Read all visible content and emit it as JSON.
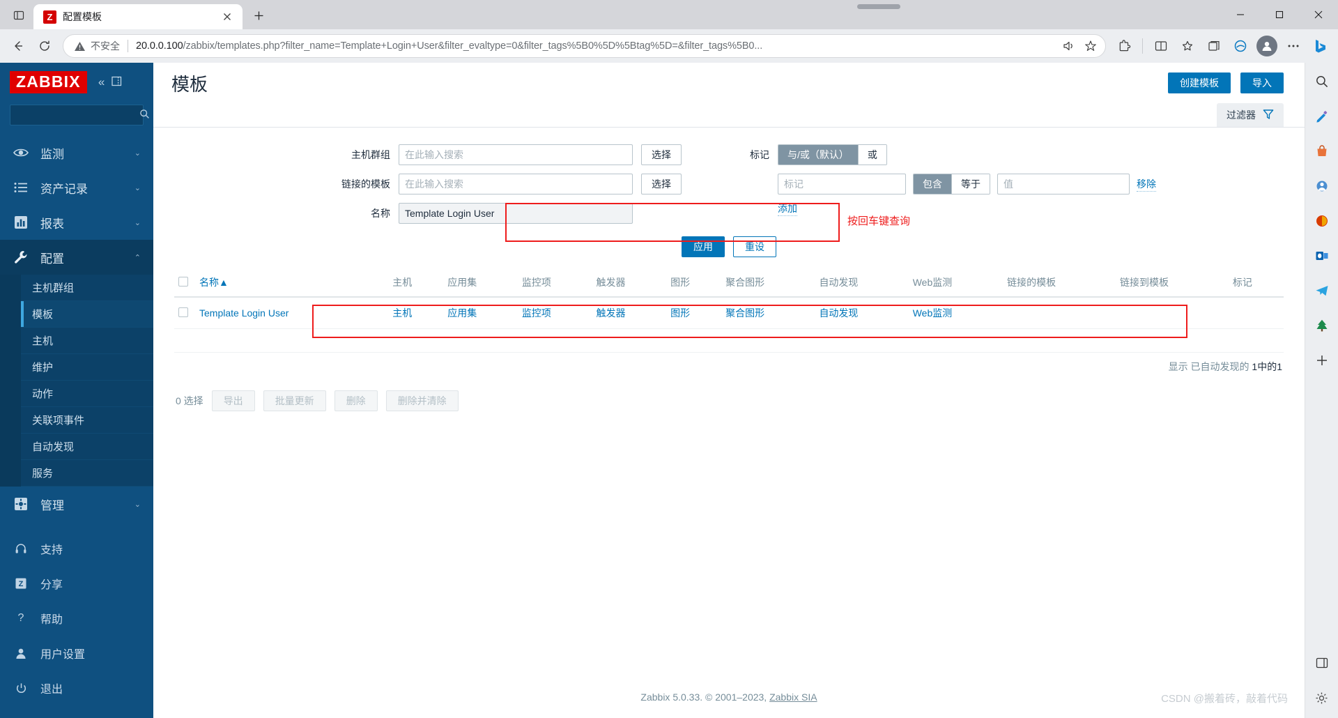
{
  "browser": {
    "tab": {
      "title": "配置模板",
      "favicon_letter": "Z"
    },
    "new_tab_label": "+",
    "url_secure_label": "不安全",
    "url_host": "20.0.0.100",
    "url_path": "/zabbix/templates.php?filter_name=Template+Login+User&filter_evaltype=0&filter_tags%5B0%5D%5Btag%5D=&filter_tags%5B0...",
    "icons": {
      "tab_list": "tab-list-icon",
      "back": "back-arrow-icon",
      "reload": "reload-icon",
      "warning": "warning-triangle-icon",
      "read_aloud": "read-aloud-icon",
      "favorite": "star-add-icon",
      "extensions": "extensions-icon",
      "split_screen": "split-screen-icon",
      "collections": "collections-icon",
      "browser_essentials": "browser-essentials-icon",
      "profile": "profile-avatar-icon",
      "settings_more": "more-options-icon",
      "copilot": "bing-copilot-icon",
      "minimize": "minimize-icon",
      "maximize": "maximize-icon",
      "close": "close-icon"
    }
  },
  "sidebar": {
    "logo": "ZABBIX",
    "collapse_icon": "chevrons-left-icon",
    "pin_icon": "pin-sidebar-icon",
    "search_placeholder": "",
    "search_icon": "search-icon",
    "nav": [
      {
        "label": "监测",
        "icon": "eye-icon",
        "caret": "chevron-down-icon",
        "active": false
      },
      {
        "label": "资产记录",
        "icon": "list-icon",
        "caret": "chevron-down-icon",
        "active": false
      },
      {
        "label": "报表",
        "icon": "bar-chart-icon",
        "caret": "chevron-down-icon",
        "active": false
      },
      {
        "label": "配置",
        "icon": "wrench-icon",
        "caret": "chevron-up-icon",
        "active": true
      }
    ],
    "submenu": [
      {
        "label": "主机群组",
        "selected": false
      },
      {
        "label": "模板",
        "selected": true
      },
      {
        "label": "主机",
        "selected": false
      },
      {
        "label": "维护",
        "selected": false
      },
      {
        "label": "动作",
        "selected": false
      },
      {
        "label": "关联项事件",
        "selected": false
      },
      {
        "label": "自动发现",
        "selected": false
      },
      {
        "label": "服务",
        "selected": false
      }
    ],
    "admin": {
      "label": "管理",
      "icon": "gear-icon",
      "caret": "chevron-down-icon"
    },
    "bottom": [
      {
        "label": "支持",
        "icon": "headset-icon"
      },
      {
        "label": "分享",
        "icon": "zabbix-share-icon"
      },
      {
        "label": "帮助",
        "icon": "question-mark-icon"
      },
      {
        "label": "用户设置",
        "icon": "person-icon"
      },
      {
        "label": "退出",
        "icon": "power-icon"
      }
    ]
  },
  "header": {
    "title": "模板",
    "create_button": "创建模板",
    "import_button": "导入"
  },
  "filter": {
    "tab_label": "过滤器",
    "tab_icon": "funnel-icon",
    "host_group_label": "主机群组",
    "host_group_placeholder": "在此输入搜索",
    "host_group_value": "",
    "linked_template_label": "链接的模板",
    "linked_template_placeholder": "在此输入搜索",
    "linked_template_value": "",
    "select_button": "选择",
    "name_label": "名称",
    "name_value": "Template Login User",
    "tags_label": "标记",
    "evaltype_andor": "与/或（默认）",
    "evaltype_or": "或",
    "tag_placeholder": "标记",
    "operator_contains": "包含",
    "operator_equals": "等于",
    "value_placeholder": "值",
    "remove_link": "移除",
    "add_link": "添加",
    "apply_button": "应用",
    "reset_button": "重设",
    "annotation_text": "按回车键查询",
    "annotation_color": "#ee1c1c"
  },
  "table": {
    "columns": [
      "名称",
      "主机",
      "应用集",
      "监控项",
      "触发器",
      "图形",
      "聚合图形",
      "自动发现",
      "Web监测",
      "链接的模板",
      "链接到模板",
      "标记"
    ],
    "sort_indicator": "▲",
    "rows": [
      {
        "name": "Template Login User",
        "hosts": "主机",
        "applications": "应用集",
        "items": "监控项",
        "triggers": "触发器",
        "graphs": "图形",
        "screens": "聚合图形",
        "discovery": "自动发现",
        "web": "Web监测",
        "linked_templates": "",
        "linked_to_templates": "",
        "tags": ""
      }
    ],
    "footer_prefix": "显示",
    "footer_mid": "已自动发现的",
    "footer_count": "1中的1",
    "selected_label": "0 选择",
    "actions": [
      "导出",
      "批量更新",
      "删除",
      "删除并清除"
    ]
  },
  "footer": {
    "text": "Zabbix 5.0.33. © 2001–2023,",
    "link": "Zabbix SIA"
  },
  "watermark": "CSDN @搬着砖，敲着代码",
  "rail": {
    "items": [
      "search-icon",
      "pen-highlight-icon",
      "shopping-bag-icon",
      "games-icon",
      "microsoft-365-icon",
      "outlook-icon",
      "telegram-icon",
      "tree-icon",
      "add-tool-icon"
    ],
    "bottom": [
      "sidebar-toggle-icon",
      "rail-settings-icon"
    ]
  },
  "colors": {
    "zabbix_blue": "#0f5080",
    "accent": "#0275b8",
    "logo_red": "#e00000",
    "annotation_red": "#ee1c1c"
  }
}
